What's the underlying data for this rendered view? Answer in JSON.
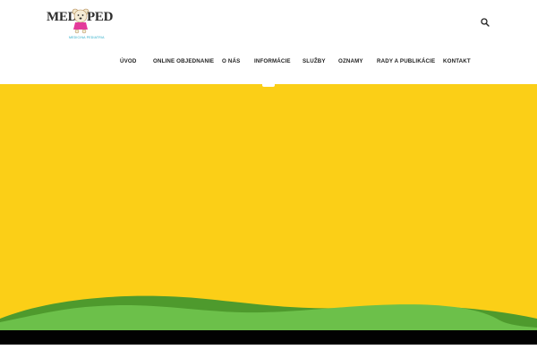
{
  "logo": {
    "left_text": "MED",
    "right_text": "PED",
    "tagline": "MEDICINA PEDIATRIA"
  },
  "header": {
    "search_icon": "search-icon"
  },
  "nav": {
    "items": [
      {
        "label": "ÚVOD"
      },
      {
        "label": "ONLINE OBJEDNANIE"
      },
      {
        "label": "O NÁS"
      },
      {
        "label": "INFORMÁCIE"
      },
      {
        "label": "SLUŽBY"
      },
      {
        "label": "OZNAMY"
      },
      {
        "label": "RADY A PUBLIKÁCIE"
      },
      {
        "label": "KONTAKT"
      }
    ],
    "active_index": 3
  },
  "colors": {
    "hero_background": "#fbcf17",
    "hill_light": "#6cc04a",
    "hill_dark": "#4e9a2d",
    "footer": "#020202"
  }
}
